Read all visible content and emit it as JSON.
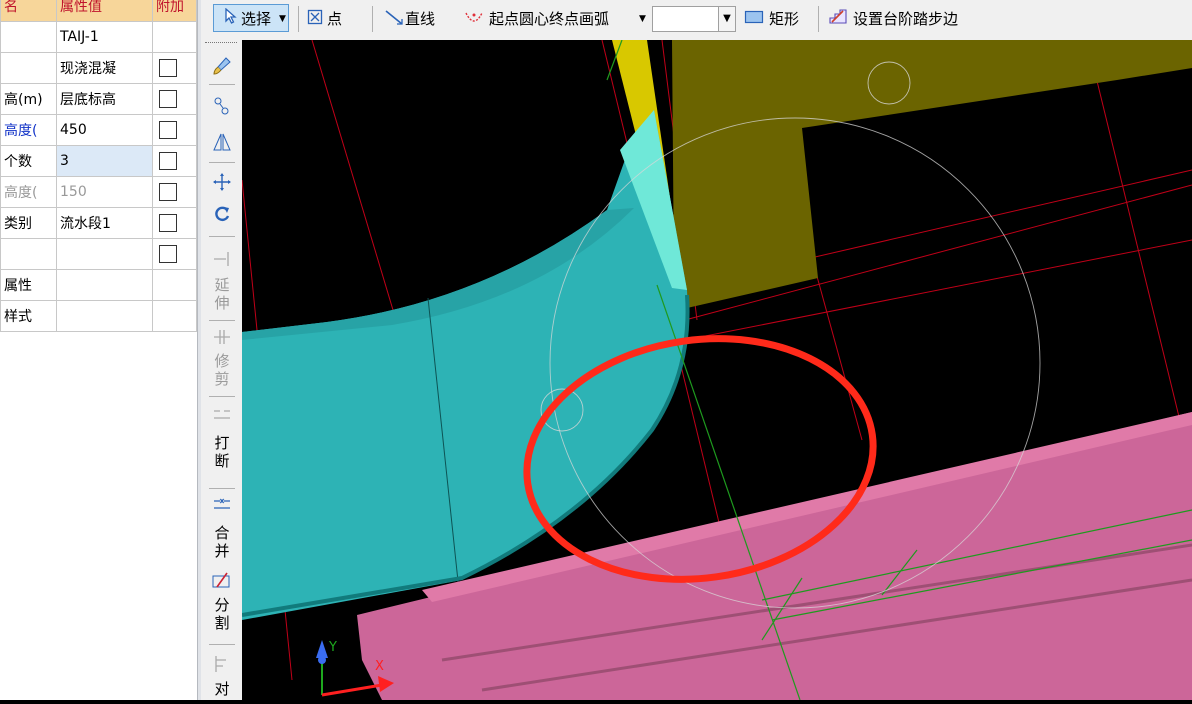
{
  "properties": {
    "header": {
      "name": "名",
      "value": "属性值",
      "extra": "附加"
    },
    "rows": [
      {
        "name": "",
        "value": "TAIJ-1",
        "checkbox": false,
        "name_color": "normal",
        "value_color": "normal"
      },
      {
        "name": "",
        "value": "现浇混凝",
        "checkbox": true,
        "name_color": "normal",
        "value_color": "normal"
      },
      {
        "name": "高(m)",
        "value": "层底标高",
        "checkbox": true,
        "name_color": "normal",
        "value_color": "normal"
      },
      {
        "name": "高度(",
        "value": "450",
        "checkbox": true,
        "name_color": "blue",
        "value_color": "normal"
      },
      {
        "name": "个数",
        "value": "3",
        "checkbox": true,
        "name_color": "normal",
        "value_color": "normal",
        "selected": true
      },
      {
        "name": "高度(",
        "value": "150",
        "checkbox": true,
        "name_color": "gray",
        "value_color": "gray"
      },
      {
        "name": "类别",
        "value": "流水段1",
        "checkbox": true,
        "name_color": "normal",
        "value_color": "normal"
      },
      {
        "name": "",
        "value": "",
        "checkbox": true,
        "name_color": "normal",
        "value_color": "normal"
      },
      {
        "name": "属性",
        "value": "",
        "checkbox": false,
        "name_color": "normal",
        "value_color": "normal"
      },
      {
        "name": "样式",
        "value": "",
        "checkbox": false,
        "name_color": "normal",
        "value_color": "normal"
      }
    ]
  },
  "toolbar": {
    "select_label": "选择",
    "point_label": "点",
    "line_label": "直线",
    "arc_label": "起点圆心终点画弧",
    "rect_label": "矩形",
    "step_label": "设置台阶踏步边"
  },
  "side_tools": {
    "extend": "延伸",
    "trim": "修剪",
    "break": "打断",
    "merge": "合并",
    "split": "分割",
    "align": "对"
  },
  "axis_labels": {
    "y": "Y",
    "x": "X"
  },
  "colors": {
    "canvas_bg": "#000000",
    "stair_cyan": "#2db3b5",
    "beam_pink": "#cc6699",
    "wall_olive": "#6b6400",
    "highlight_red": "#ff2a1a",
    "grid_red": "#c00018",
    "grid_green": "#1e9a1e"
  }
}
